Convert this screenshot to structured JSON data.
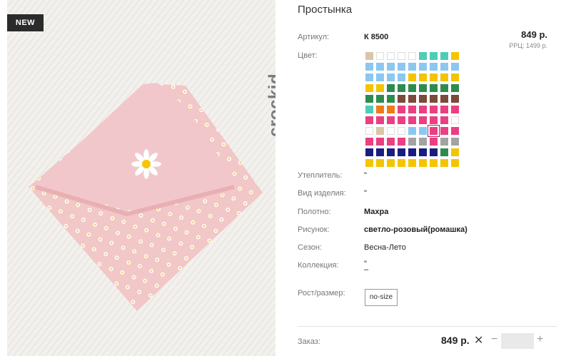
{
  "image": {
    "badge": "NEW",
    "brand": "crockid"
  },
  "product": {
    "title": "Простынка",
    "article_label": "Артикул:",
    "article_value": "К 8500",
    "price": "849 р.",
    "rrp": "РРЦ: 1499 р.",
    "color_label": "Цвет:",
    "insulation_label": "Утеплитель:",
    "insulation_value": "\"",
    "type_label": "Вид изделия:",
    "type_value": "\"",
    "fabric_label": "Полотно:",
    "fabric_value": "Махра",
    "pattern_label": "Рисунок:",
    "pattern_value": "светло-розовый(ромашка)",
    "season_label": "Сезон:",
    "season_value": "Весна-Лето",
    "collection_label": "Коллекция:",
    "collection_value_1": "\"",
    "collection_value_2": "–",
    "size_label": "Рост/размер:",
    "size_value": "no-size"
  },
  "order": {
    "label": "Заказ:",
    "price": "849 р.",
    "remove_glyph": "✕",
    "minus": "−",
    "plus": "+"
  },
  "palette": {
    "colors": {
      "B": "#d8c6a7",
      "W": "#ffffff",
      "T": "#4ecdb6",
      "Y": "#f5c400",
      "L": "#8cc7f0",
      "G": "#2e8b4f",
      "R": "#7a4a3a",
      "P": "#ea3f82",
      "O": "#ef7a1a",
      "Gr": "#a3a3a3",
      "N": "#1a1d80"
    },
    "rows": [
      [
        "B",
        "W",
        "W",
        "W",
        "W",
        "T",
        "T",
        "T",
        "Y"
      ],
      [
        "L",
        "L",
        "L",
        "L",
        "L",
        "L",
        "L",
        "L",
        "L"
      ],
      [
        "L",
        "L",
        "L",
        "L",
        "Y",
        "Y",
        "Y",
        "Y",
        "Y"
      ],
      [
        "Y",
        "Y",
        "G",
        "G",
        "G",
        "G",
        "G",
        "G",
        "G"
      ],
      [
        "G",
        "G",
        "G",
        "R",
        "R",
        "R",
        "R",
        "R",
        "R"
      ],
      [
        "T",
        "O",
        "O",
        "P",
        "P",
        "P",
        "P",
        "P",
        "P"
      ],
      [
        "P",
        "P",
        "P",
        "P",
        "P",
        "P",
        "P",
        "P",
        "W"
      ],
      [
        "W",
        "B",
        "W",
        "W",
        "L",
        "L",
        "P",
        "P",
        "P"
      ],
      [
        "P",
        "P",
        "P",
        "P",
        "Gr",
        "Gr",
        "P",
        "Gr",
        "Gr"
      ],
      [
        "N",
        "N",
        "N",
        "N",
        "N",
        "N",
        "N",
        "G",
        "Y"
      ],
      [
        "Y",
        "Y",
        "Y",
        "Y",
        "Y",
        "Y",
        "Y",
        "Y",
        "Y"
      ]
    ],
    "selected": [
      7,
      6
    ]
  }
}
